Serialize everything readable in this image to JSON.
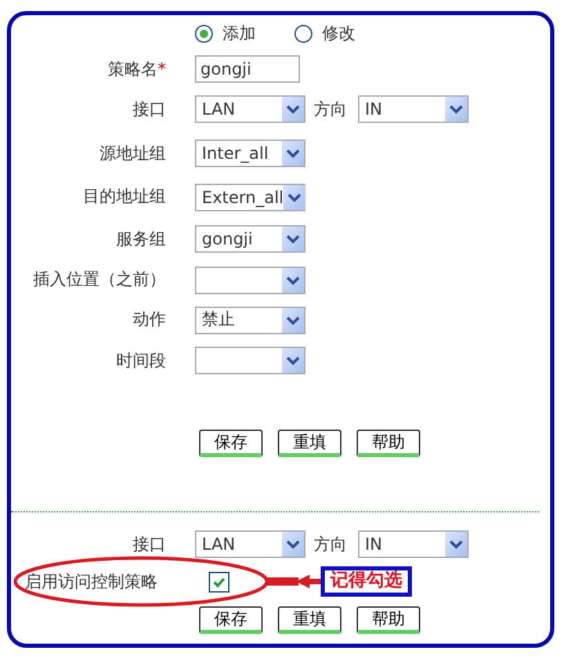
{
  "mode_options": [
    {
      "label": "添加",
      "selected": true
    },
    {
      "label": "修改",
      "selected": false
    }
  ],
  "policy_form": {
    "name_field": {
      "label": "策略名",
      "required_mark": "*",
      "value": "gongji"
    },
    "interface": {
      "label": "接口",
      "value": "LAN"
    },
    "direction": {
      "label": "方向",
      "value": "IN"
    },
    "selects": [
      {
        "label": "源地址组",
        "value": "Inter_all"
      },
      {
        "label": "目的地址组",
        "value": "Extern_all"
      },
      {
        "label": "服务组",
        "value": "gongji"
      },
      {
        "label": "插入位置（之前）"
      },
      {
        "label": "动作",
        "value": "禁止"
      },
      {
        "label": "时间段"
      }
    ],
    "buttons": [
      "保存",
      "重填",
      "帮助"
    ]
  },
  "enable_section": {
    "interface": {
      "label": "接口",
      "value": "LAN"
    },
    "direction": {
      "label": "方向",
      "value": "IN"
    },
    "enable_checkbox": {
      "label": "启用访问控制策略",
      "checked": true
    },
    "callout": "记得勾选",
    "buttons": [
      "保存",
      "重填",
      "帮助"
    ]
  }
}
